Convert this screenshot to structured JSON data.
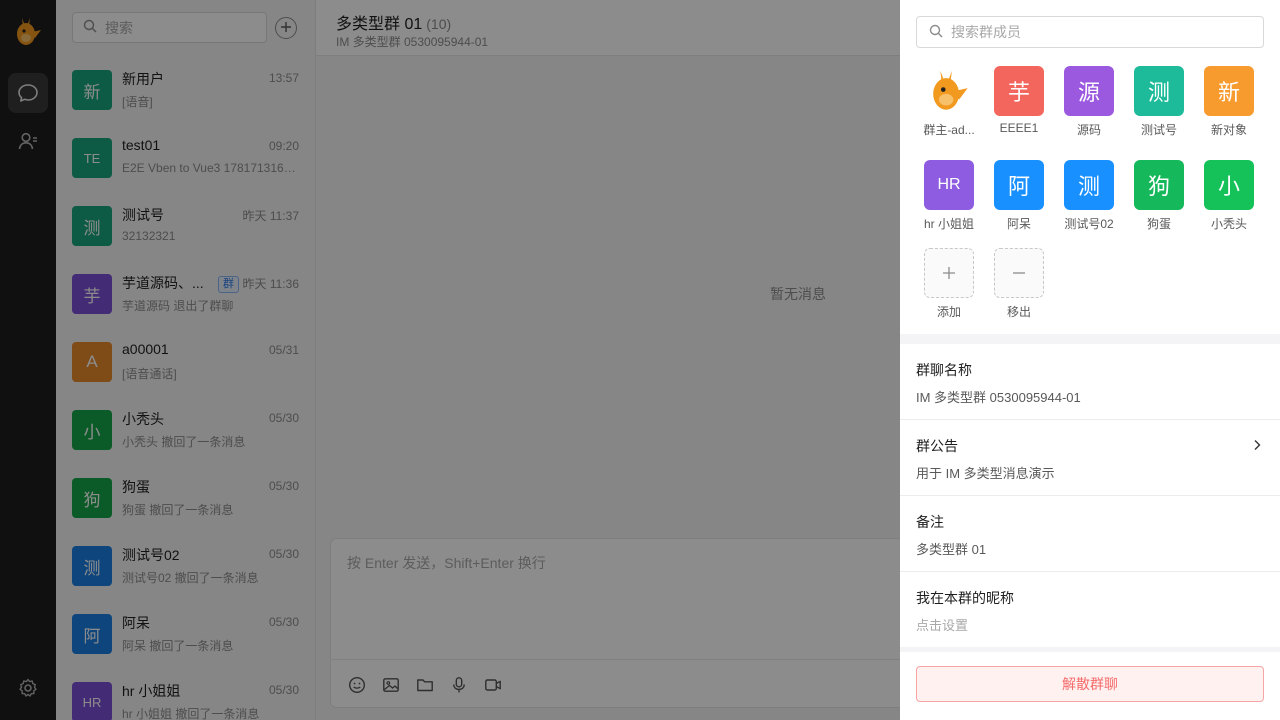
{
  "icons": {
    "logo": "mascot-logo-icon",
    "chat": "chat-bubble-icon",
    "contacts": "contacts-icon",
    "settings": "gear-icon",
    "search": "search-icon",
    "add": "plus-icon"
  },
  "sidebar": {
    "search_placeholder": "搜索",
    "conversations": [
      {
        "avatar": "新",
        "color": "#19a67c",
        "name": "新用户",
        "time": "13:57",
        "preview": "[语音]"
      },
      {
        "avatar": "TE",
        "color": "#19a67c",
        "name": "test01",
        "time": "09:20",
        "preview": "E2E Vben to Vue3 1781713160..."
      },
      {
        "avatar": "测",
        "color": "#19a67c",
        "name": "测试号",
        "time": "昨天 11:37",
        "preview": "32132321"
      },
      {
        "avatar": "芋",
        "color": "#7b4fd6",
        "name": "芋道源码、...",
        "tag": "群",
        "time": "昨天 11:36",
        "preview": "芋道源码 退出了群聊"
      },
      {
        "avatar": "A",
        "color": "#e8892b",
        "name": "a00001",
        "time": "05/31",
        "preview": "[语音通话]"
      },
      {
        "avatar": "小",
        "color": "#15a64a",
        "name": "小秃头",
        "time": "05/30",
        "preview": "小秃头 撤回了一条消息"
      },
      {
        "avatar": "狗",
        "color": "#15a64a",
        "name": "狗蛋",
        "time": "05/30",
        "preview": "狗蛋 撤回了一条消息"
      },
      {
        "avatar": "测",
        "color": "#1a7fe3",
        "name": "测试号02",
        "time": "05/30",
        "preview": "测试号02 撤回了一条消息"
      },
      {
        "avatar": "阿",
        "color": "#1a7fe3",
        "name": "阿呆",
        "time": "05/30",
        "preview": "阿呆 撤回了一条消息"
      },
      {
        "avatar": "HR",
        "color": "#7b4fd6",
        "name": "hr 小姐姐",
        "time": "05/30",
        "preview": "hr 小姐姐 撤回了一条消息"
      }
    ]
  },
  "chat": {
    "title": "多类型群 01",
    "member_count": "(10)",
    "subtitle": "IM 多类型群 0530095944-01",
    "empty_text": "暂无消息",
    "input_placeholder": "按 Enter 发送，Shift+Enter 换行",
    "tools": [
      "emoji-icon",
      "image-icon",
      "folder-icon",
      "microphone-icon",
      "video-icon"
    ]
  },
  "drawer": {
    "search_placeholder": "搜索群成员",
    "members": [
      {
        "avatar": "",
        "color": "",
        "name": "群主-ad...",
        "owner": true
      },
      {
        "avatar": "芋",
        "color": "#f2665e",
        "name": "EEEE1"
      },
      {
        "avatar": "源",
        "color": "#9b59e0",
        "name": "源码"
      },
      {
        "avatar": "测",
        "color": "#1dbb9a",
        "name": "测试号"
      },
      {
        "avatar": "新",
        "color": "#f79b2f",
        "name": "新对象"
      },
      {
        "avatar": "HR",
        "color": "#8e5ce0",
        "name": "hr 小姐姐"
      },
      {
        "avatar": "阿",
        "color": "#1890ff",
        "name": "阿呆"
      },
      {
        "avatar": "测",
        "color": "#1890ff",
        "name": "测试号02"
      },
      {
        "avatar": "狗",
        "color": "#15b85a",
        "name": "狗蛋"
      },
      {
        "avatar": "小",
        "color": "#15c25a",
        "name": "小秃头"
      }
    ],
    "add_label": "添加",
    "remove_label": "移出",
    "group_name_label": "群聊名称",
    "group_name_value": "IM 多类型群 0530095944-01",
    "notice_label": "群公告",
    "notice_value": "用于 IM 多类型消息演示",
    "remark_label": "备注",
    "remark_value": "多类型群 01",
    "nickname_label": "我在本群的昵称",
    "nickname_value": "点击设置",
    "dissolve_label": "解散群聊"
  }
}
